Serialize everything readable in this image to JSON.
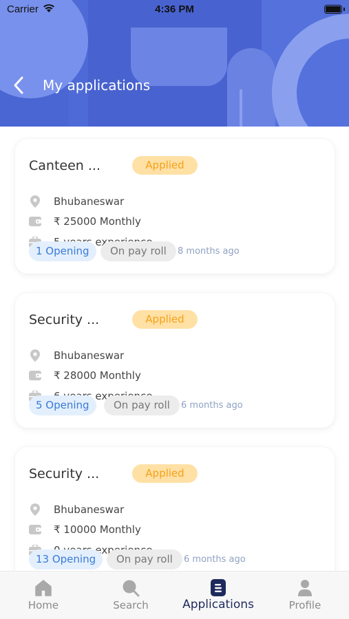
{
  "status_bar": {
    "carrier": "Carrier",
    "time": "4:36 PM"
  },
  "header": {
    "title": "My applications"
  },
  "colors": {
    "brand": "#4d6ad6",
    "applied_bg": "#ffe0a5",
    "applied_text": "#f3a21a",
    "opening_text": "#3a7ad8",
    "tab_active": "#1e2a5c"
  },
  "applications": [
    {
      "title": "Canteen ...",
      "status": "Applied",
      "location": "Bhubaneswar",
      "salary": "₹ 25000 Monthly",
      "experience": "5 years experience",
      "openings": "1 Opening",
      "payroll": "On pay roll",
      "posted": "8 months ago"
    },
    {
      "title": "Security ...",
      "status": "Applied",
      "location": "Bhubaneswar",
      "salary": "₹ 28000 Monthly",
      "experience": "6 years experience",
      "openings": "5 Opening",
      "payroll": "On pay roll",
      "posted": "6 months ago"
    },
    {
      "title": "Security ...",
      "status": "Applied",
      "location": "Bhubaneswar",
      "salary": "₹ 10000 Monthly",
      "experience": "0 years experience",
      "openings": "13 Opening",
      "payroll": "On pay roll",
      "posted": "6 months ago"
    }
  ],
  "tabs": [
    {
      "label": "Home",
      "icon": "home-icon"
    },
    {
      "label": "Search",
      "icon": "search-icon"
    },
    {
      "label": "Applications",
      "icon": "applications-icon",
      "active": true
    },
    {
      "label": "Profile",
      "icon": "profile-icon"
    }
  ]
}
